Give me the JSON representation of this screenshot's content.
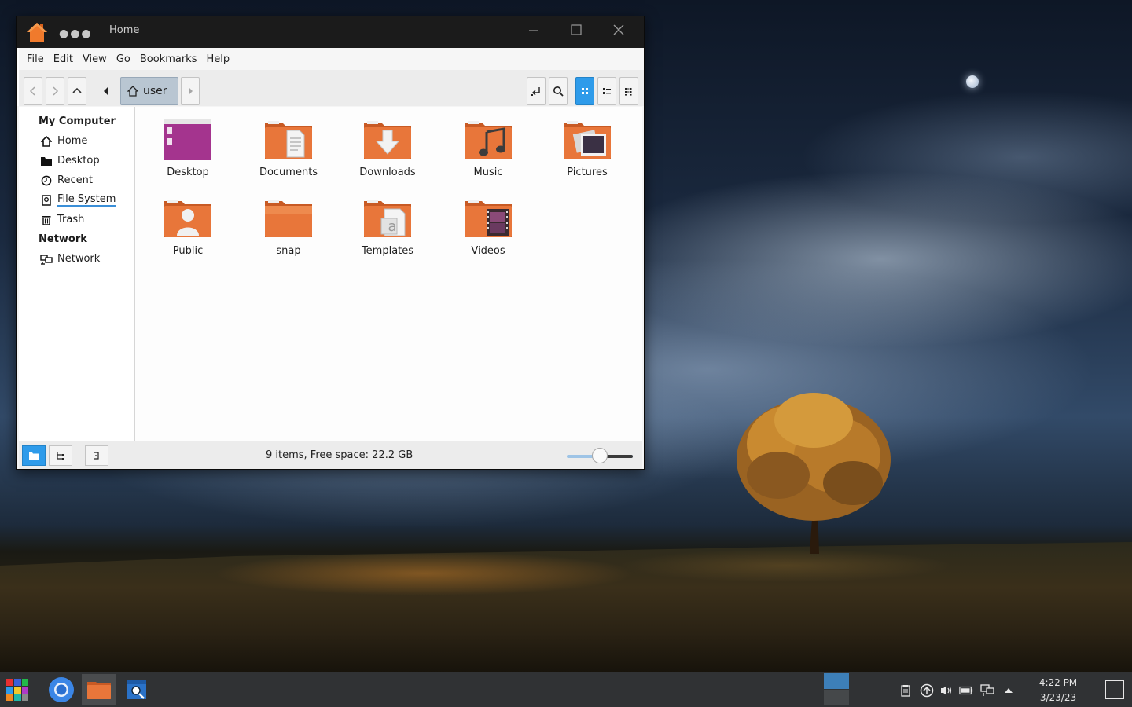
{
  "window": {
    "title": "Home",
    "menu": [
      "File",
      "Edit",
      "View",
      "Go",
      "Bookmarks",
      "Help"
    ],
    "breadcrumb": "user"
  },
  "sidebar": {
    "sections": [
      {
        "title": "My Computer",
        "items": [
          {
            "label": "Home",
            "icon": "home-icon"
          },
          {
            "label": "Desktop",
            "icon": "folder-icon"
          },
          {
            "label": "Recent",
            "icon": "clock-icon"
          },
          {
            "label": "File System",
            "icon": "drive-icon"
          },
          {
            "label": "Trash",
            "icon": "trash-icon"
          }
        ]
      },
      {
        "title": "Network",
        "items": [
          {
            "label": "Network",
            "icon": "network-icon"
          }
        ]
      }
    ]
  },
  "files": [
    {
      "name": "Desktop",
      "kind": "desktop"
    },
    {
      "name": "Documents",
      "kind": "documents"
    },
    {
      "name": "Downloads",
      "kind": "downloads"
    },
    {
      "name": "Music",
      "kind": "music"
    },
    {
      "name": "Pictures",
      "kind": "pictures"
    },
    {
      "name": "Public",
      "kind": "public"
    },
    {
      "name": "snap",
      "kind": "plain"
    },
    {
      "name": "Templates",
      "kind": "templates"
    },
    {
      "name": "Videos",
      "kind": "videos"
    }
  ],
  "status": {
    "text": "9 items, Free space: 22.2 GB",
    "zoom_fraction": 0.5
  },
  "taskbar": {
    "clock_time": "4:22 PM",
    "clock_date": "3/23/23"
  },
  "colors": {
    "accent": "#2e9bea",
    "folder_orange": "#e8763a",
    "desktop_purple": "#a4348e"
  }
}
